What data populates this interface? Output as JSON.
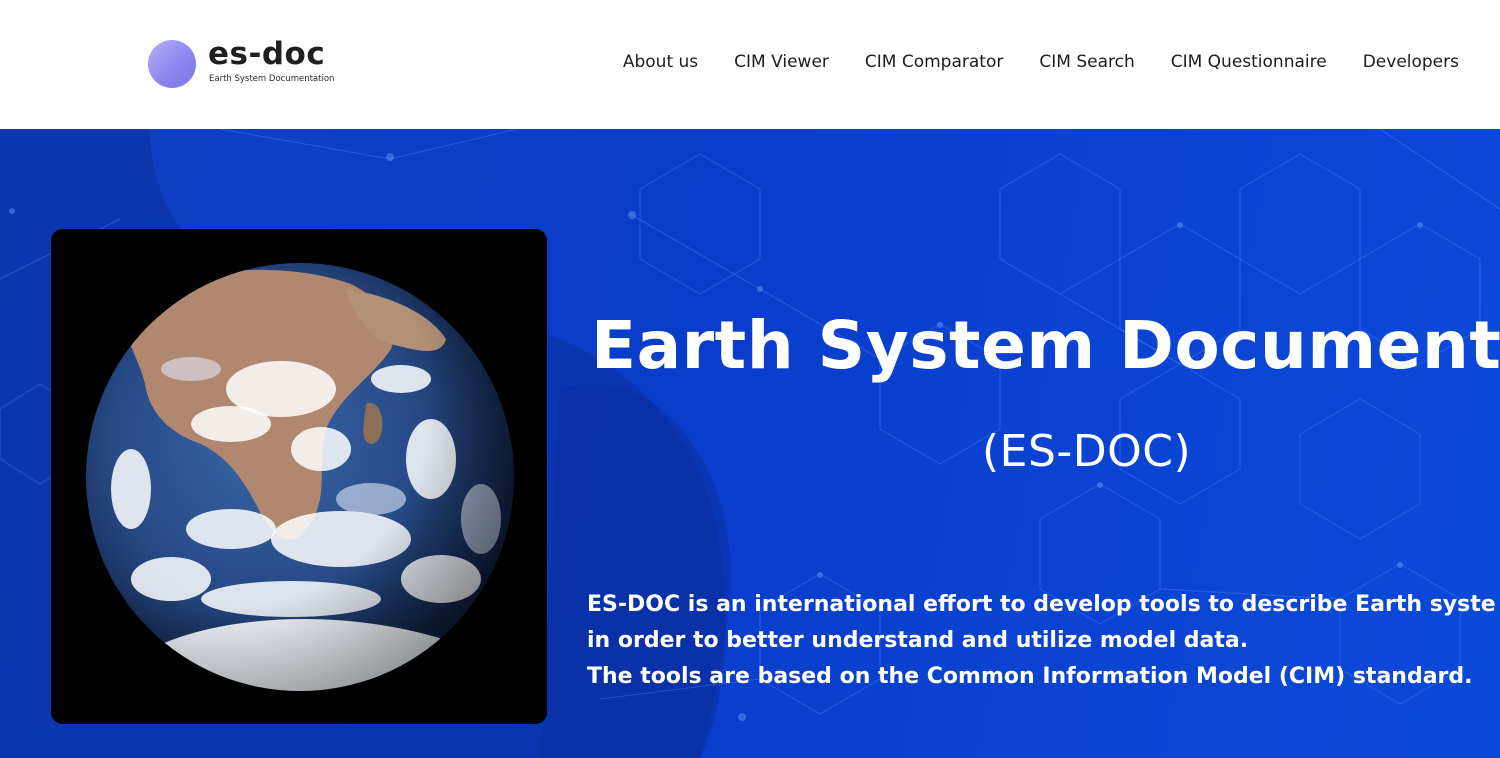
{
  "brand": {
    "name": "es-doc",
    "tagline": "Earth System Documentation",
    "logo_icon": "purple-sphere-icon"
  },
  "nav": {
    "items": [
      {
        "label": "About us"
      },
      {
        "label": "CIM Viewer"
      },
      {
        "label": "CIM Comparator"
      },
      {
        "label": "CIM Search"
      },
      {
        "label": "CIM Questionnaire"
      },
      {
        "label": "Developers"
      }
    ]
  },
  "hero": {
    "title": "Earth System Documentat",
    "subtitle": "(ES-DOC)",
    "description_lines": [
      "ES-DOC is an international effort to develop tools to describe Earth syste",
      "in order to better understand and utilize model data.",
      "The tools are based on the Common Information Model (CIM) standard."
    ],
    "image": "earth-from-space-image"
  },
  "colors": {
    "hero_background": "#0b44d4",
    "text_on_hero": "#ffffff",
    "header_background": "#ffffff",
    "nav_text": "#1d1d1d"
  }
}
